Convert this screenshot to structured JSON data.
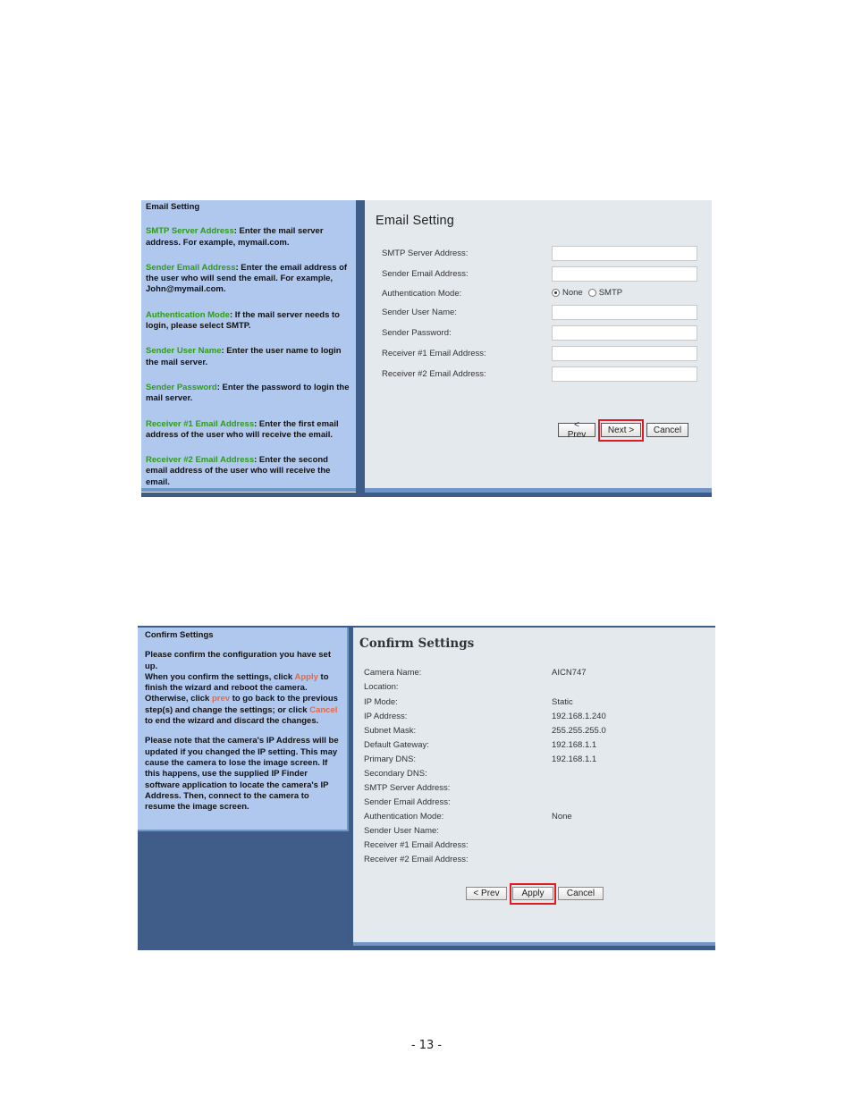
{
  "email_setting": {
    "help": {
      "title": "Email Setting",
      "items": [
        {
          "term": "SMTP Server Address",
          "desc": ": Enter the mail server address. For example, mymail.com."
        },
        {
          "term": "Sender Email Address",
          "desc": ": Enter the email address of the user who will send the email. For example, John@mymail.com."
        },
        {
          "term": "Authentication Mode",
          "desc": ": If the mail server needs to login, please select SMTP."
        },
        {
          "term": "Sender User Name",
          "desc": ": Enter the user name to login the mail server."
        },
        {
          "term": "Sender Password",
          "desc": ": Enter the password to login the mail server."
        },
        {
          "term": "Receiver #1 Email Address",
          "desc": ": Enter the first email address of the user who will receive the email."
        },
        {
          "term": "Receiver #2 Email Address",
          "desc": ": Enter the second email address of the user who will receive the email."
        }
      ]
    },
    "title": "Email Setting",
    "fields": {
      "smtp_server": {
        "label": "SMTP Server Address:",
        "value": ""
      },
      "sender_email": {
        "label": "Sender Email Address:",
        "value": ""
      },
      "auth_mode": {
        "label": "Authentication Mode:",
        "options": [
          "None",
          "SMTP"
        ],
        "selected": "None"
      },
      "sender_user": {
        "label": "Sender User Name:",
        "value": ""
      },
      "sender_password": {
        "label": "Sender Password:",
        "value": ""
      },
      "receiver1": {
        "label": "Receiver #1 Email Address:",
        "value": ""
      },
      "receiver2": {
        "label": "Receiver #2 Email Address:",
        "value": ""
      }
    },
    "buttons": {
      "prev": "< Prev",
      "next": "Next >",
      "cancel": "Cancel"
    },
    "highlight_color": "#e01b24"
  },
  "confirm_settings": {
    "help": {
      "title": "Confirm Settings",
      "p1_a": "Please confirm the configuration you have set up.",
      "p1_b": "When you confirm the settings, click ",
      "p1_apply": "Apply",
      "p1_c": " to finish the wizard and reboot the camera. Otherwise, click ",
      "p1_prev": "prev",
      "p1_d": " to go back to the previous step(s) and change the settings; or click ",
      "p1_cancel": "Cancel",
      "p1_e": " to end the wizard and discard the changes.",
      "p2": "Please note that the camera's IP Address will be updated if you changed the IP setting. This may cause the camera to lose the image screen. If this happens, use the supplied IP Finder software application to locate the camera's IP Address. Then, connect to the camera to resume the image screen."
    },
    "title": "Confirm Settings",
    "rows": [
      {
        "label": "Camera Name:",
        "value": "AICN747"
      },
      {
        "label": "Location:",
        "value": ""
      },
      {
        "label": "IP Mode:",
        "value": "Static"
      },
      {
        "label": "IP Address:",
        "value": "192.168.1.240"
      },
      {
        "label": "Subnet Mask:",
        "value": "255.255.255.0"
      },
      {
        "label": "Default Gateway:",
        "value": "192.168.1.1"
      },
      {
        "label": "Primary DNS:",
        "value": "192.168.1.1"
      },
      {
        "label": "Secondary DNS:",
        "value": ""
      },
      {
        "label": "SMTP Server Address:",
        "value": ""
      },
      {
        "label": "Sender Email Address:",
        "value": ""
      },
      {
        "label": "Authentication Mode:",
        "value": "None"
      },
      {
        "label": "Sender User Name:",
        "value": ""
      },
      {
        "label": "Receiver #1 Email Address:",
        "value": ""
      },
      {
        "label": "Receiver #2 Email Address:",
        "value": ""
      }
    ],
    "buttons": {
      "prev": "< Prev",
      "apply": "Apply",
      "cancel": "Cancel"
    },
    "accent_color": "#f0643c"
  },
  "page_number": "- 13 -"
}
